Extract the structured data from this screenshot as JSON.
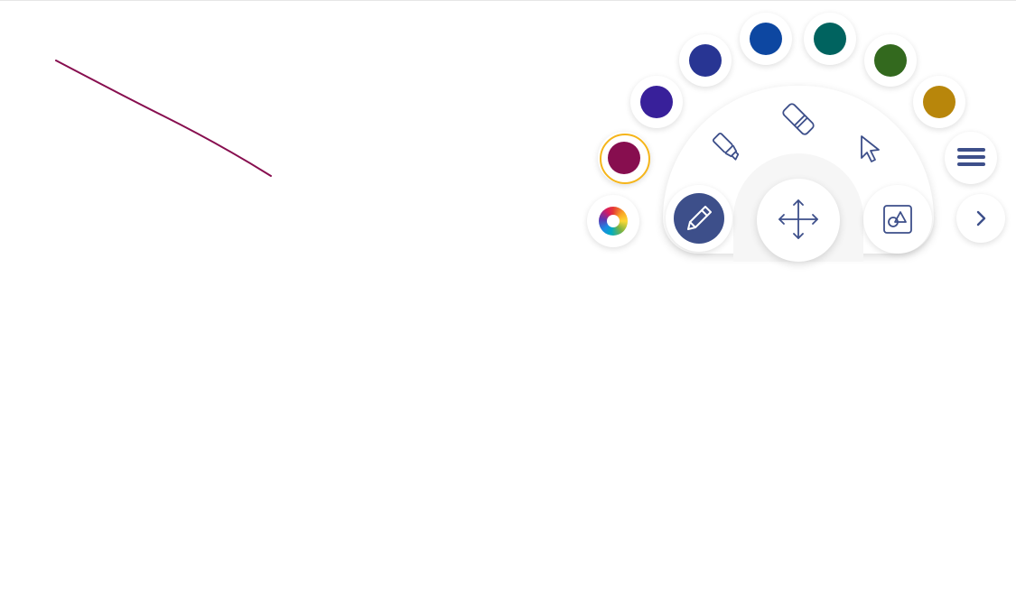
{
  "canvas": {
    "stroke": {
      "color": "#870e4f"
    }
  },
  "palette": {
    "selected_index": 0,
    "swatches": [
      {
        "name": "magenta",
        "color": "#870e4f"
      },
      {
        "name": "violet",
        "color": "#38209a"
      },
      {
        "name": "indigo",
        "color": "#283593"
      },
      {
        "name": "blue",
        "color": "#0d47a1"
      },
      {
        "name": "teal",
        "color": "#00635f"
      },
      {
        "name": "green",
        "color": "#33691e"
      },
      {
        "name": "amber",
        "color": "#b8860b"
      }
    ],
    "selection_ring_color": "#f5b51b"
  },
  "toolbar": {
    "accent": "#3d4f8a",
    "icon_color": "#3d4f8a",
    "tools": [
      {
        "name": "color-wheel-icon"
      },
      {
        "name": "pen-icon",
        "active": true
      },
      {
        "name": "highlighter-icon"
      },
      {
        "name": "eraser-icon"
      },
      {
        "name": "pointer-icon"
      },
      {
        "name": "move-icon"
      },
      {
        "name": "shapes-icon"
      },
      {
        "name": "menu-icon"
      },
      {
        "name": "chevron-right-icon"
      }
    ]
  }
}
